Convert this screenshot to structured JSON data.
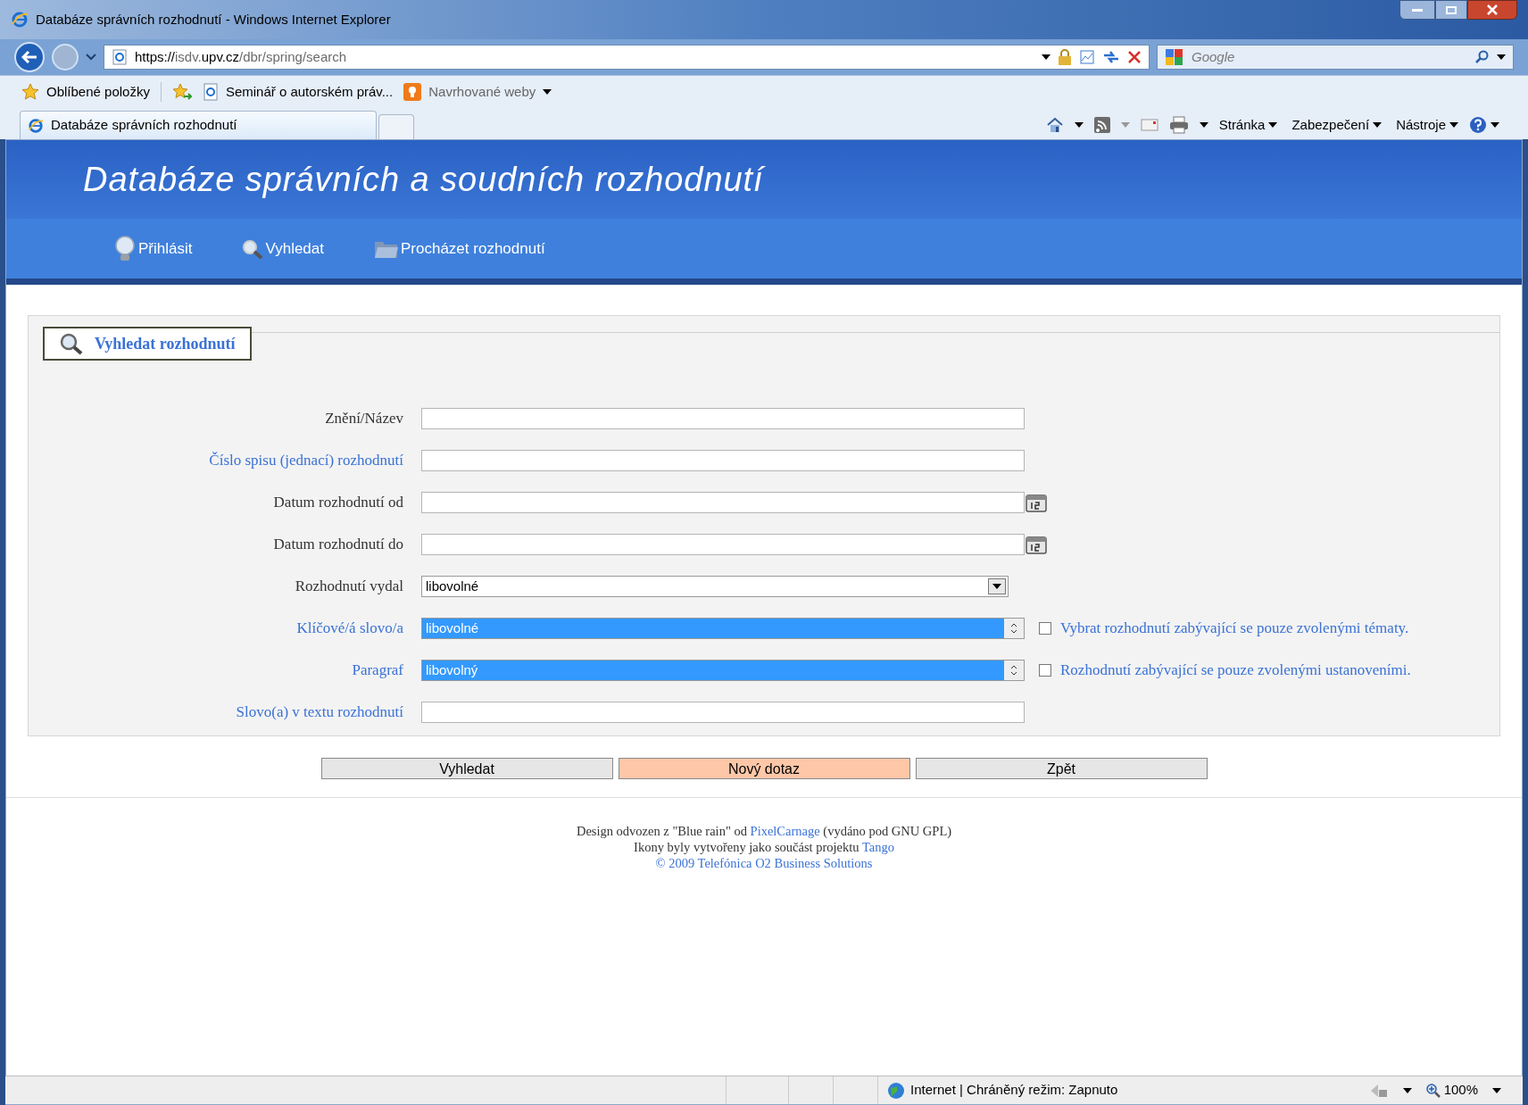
{
  "window": {
    "title": "Databáze správních rozhodnutí - Windows Internet Explorer"
  },
  "address_bar": {
    "url_scheme": "https://",
    "url_host_prefix": "isdv.",
    "url_host": "upv.cz",
    "url_path": "/dbr/spring/search"
  },
  "search_box": {
    "placeholder": "Google"
  },
  "favorites_bar": [
    {
      "kind": "favorites",
      "label": "Oblíbené položky"
    },
    {
      "kind": "page",
      "label": "Seminář o autorském práv..."
    },
    {
      "kind": "suggested",
      "label": "Navrhované weby"
    }
  ],
  "tabs": [
    {
      "label": "Databáze správních rozhodnutí",
      "selected": true
    }
  ],
  "command_bar": [
    "Stránka",
    "Zabezpečení",
    "Nástroje"
  ],
  "page": {
    "title": "Databáze správních a soudních rozhodnutí",
    "nav": [
      {
        "kind": "login",
        "label": "Přihlásit"
      },
      {
        "kind": "search",
        "label": "Vyhledat"
      },
      {
        "kind": "browse",
        "label": "Procházet rozhodnutí"
      }
    ],
    "form": {
      "legend": "Vyhledat rozhodnutí",
      "fields": [
        {
          "label": "Znění/Název",
          "link": false,
          "kind": "text"
        },
        {
          "label": "Číslo spisu (jednací) rozhodnutí",
          "link": true,
          "kind": "text"
        },
        {
          "label": "Datum rozhodnutí od",
          "link": false,
          "kind": "date"
        },
        {
          "label": "Datum rozhodnutí do",
          "link": false,
          "kind": "date"
        },
        {
          "label": "Rozhodnutí vydal",
          "link": false,
          "kind": "select",
          "value": "libovolné"
        },
        {
          "label": "Klíčové/á slovo/a",
          "link": true,
          "kind": "listbox",
          "value": "libovolné",
          "option_selected": true,
          "checkbox": {
            "checked": false,
            "label": "Vybrat rozhodnutí zabývající se pouze zvolenými tématy."
          }
        },
        {
          "label": "Paragraf",
          "link": true,
          "kind": "listbox",
          "value": "libovolný",
          "option_selected": true,
          "checkbox": {
            "checked": false,
            "label": "Rozhodnutí zabývající se pouze zvolenými ustanoveními."
          }
        },
        {
          "label": "Slovo(a) v textu rozhodnutí",
          "link": true,
          "kind": "text"
        }
      ],
      "buttons": [
        {
          "label": "Vyhledat",
          "highlighted": false
        },
        {
          "label": "Nový dotaz",
          "highlighted": true
        },
        {
          "label": "Zpět",
          "highlighted": false
        }
      ]
    },
    "footer": [
      [
        {
          "text": "Design odvozen z \"Blue rain\" od ",
          "link": false
        },
        {
          "text": "PixelCarnage",
          "link": true
        },
        {
          "text": " (vydáno pod GNU GPL)",
          "link": false
        }
      ],
      [
        {
          "text": "Ikony byly vytvořeny jako součást projektu ",
          "link": false
        },
        {
          "text": "Tango",
          "link": true
        }
      ],
      [
        {
          "text": "© 2009 Telefónica O2 Business Solutions",
          "link": true
        }
      ]
    ]
  },
  "status_bar": {
    "zone": "Internet | Chráněný režim: Zapnuto",
    "zoom": "100%"
  }
}
